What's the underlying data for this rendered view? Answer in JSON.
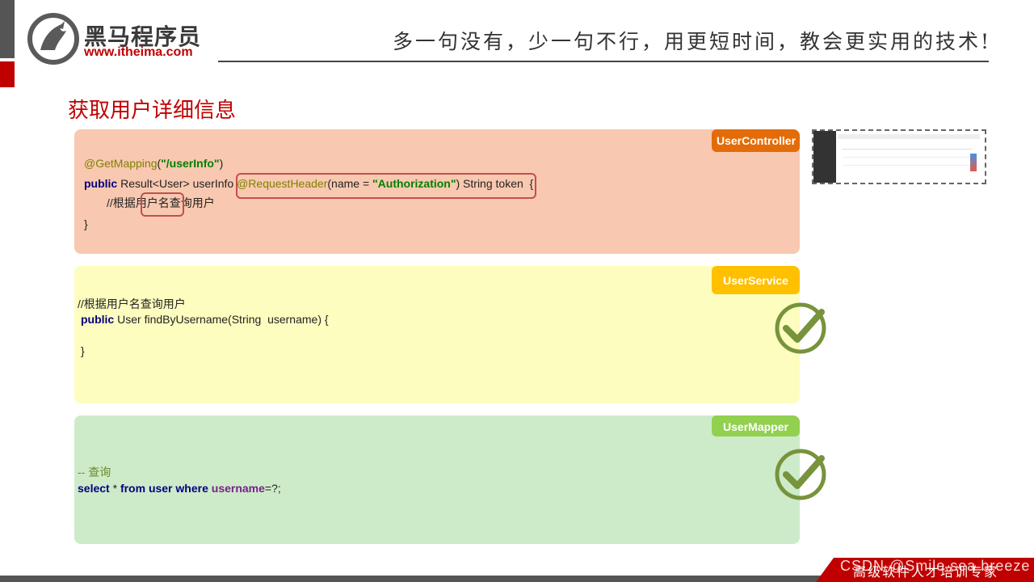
{
  "header": {
    "brand_cn": "黑马程序员",
    "brand_url": "www.itheima.com",
    "slogan": "多一句没有，少一句不行，用更短时间，教会更实用的技术!"
  },
  "title": "获取用户详细信息",
  "controller": {
    "tag": "UserController",
    "line1_ann": "@GetMapping",
    "line1_open": "(",
    "line1_str": "\"/userInfo\"",
    "line1_close": ")",
    "line2_kw": "public",
    "line2_sig": " Result<User> userInfo",
    "line2_ann": "@RequestHeader",
    "line2_mid": "(name = ",
    "line2_str": "\"Authorization\"",
    "line2_end": ") String token",
    "line2_brace": "{",
    "line3_pre": "//根据",
    "line3_hl": "用户名",
    "line3_post": "查询用户",
    "line4": "}"
  },
  "service": {
    "tag": "UserService",
    "comment": "//根据用户名查询用户",
    "kw": "public",
    "sig": " User findByUsername(String  username) {",
    "close": "}"
  },
  "mapper": {
    "tag": "UserMapper",
    "comment": "-- 查询",
    "kw1": "select",
    "star": " * ",
    "kw2": "from user where",
    "col": " username",
    "rest": "=?;"
  },
  "footer": {
    "text": "高级软件人才培训专家",
    "watermark": "CSDN @Smile sea breeze"
  },
  "colors": {
    "accent_red": "#c00000",
    "controller_bg": "#f9c8b0",
    "service_bg": "#fdfdbf",
    "mapper_bg": "#cdebc9",
    "controller_tag": "#e36c09",
    "service_tag": "#ffc000",
    "mapper_tag": "#92d050",
    "check_green": "#77933c"
  },
  "icons": [
    "horse-logo-icon",
    "check-circle-icon"
  ]
}
